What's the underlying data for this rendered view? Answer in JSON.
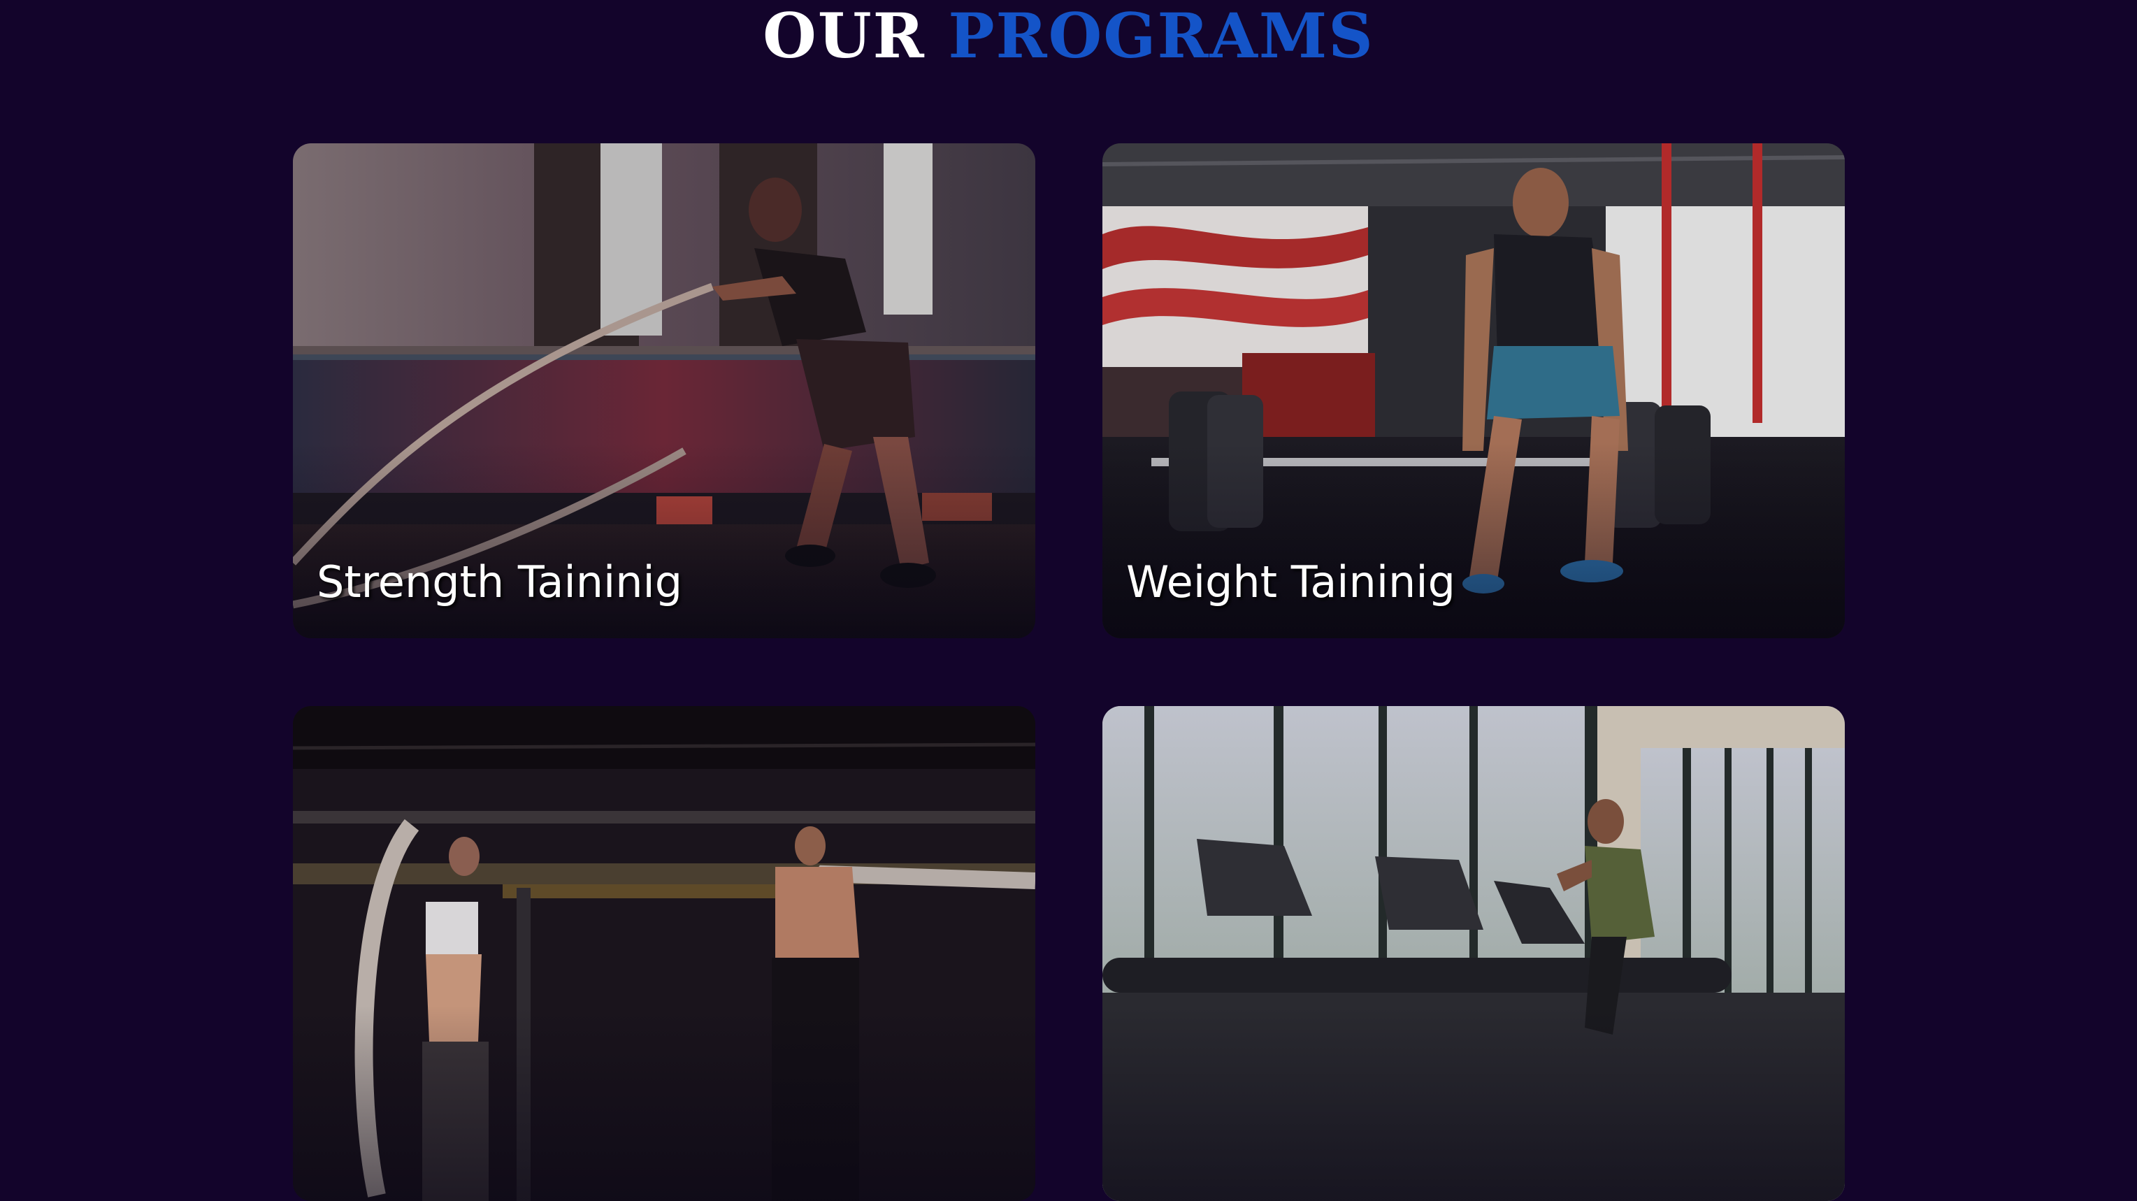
{
  "header": {
    "title_part1": "OUR",
    "title_part2": "PROGRAMS"
  },
  "colors": {
    "background": "#13042b",
    "accent": "#1454c8",
    "text": "#ffffff"
  },
  "programs": [
    {
      "label": "Strength Taininig",
      "image": "battle-rope-training-photo"
    },
    {
      "label": "Weight Taininig",
      "image": "barbell-deadlift-photo"
    },
    {
      "label": "",
      "image": "group-battle-rope-photo"
    },
    {
      "label": "",
      "image": "treadmill-cardio-photo"
    }
  ]
}
